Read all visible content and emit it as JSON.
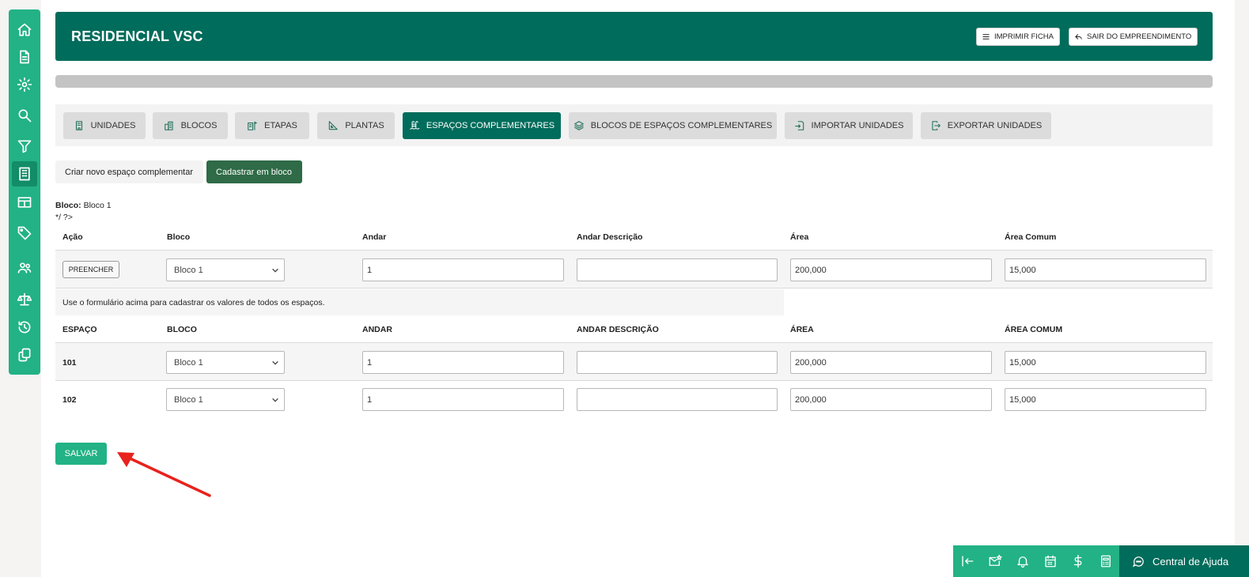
{
  "header": {
    "title": "RESIDENCIAL VSC",
    "print_label": "IMPRIMIR FICHA",
    "exit_label": "SAIR DO EMPREENDIMENTO",
    "color": "#006c5b"
  },
  "progress": {
    "percent": 0
  },
  "sidebar": {
    "items": [
      {
        "icon": "home-icon"
      },
      {
        "icon": "document-icon"
      },
      {
        "icon": "gear-icon"
      },
      {
        "icon": "search-icon"
      },
      {
        "icon": "filter-icon"
      },
      {
        "icon": "building-icon",
        "active": true
      },
      {
        "icon": "table-icon"
      },
      {
        "icon": "tag-icon"
      },
      {
        "icon": "users-icon"
      },
      {
        "icon": "scale-icon"
      },
      {
        "icon": "history-icon"
      },
      {
        "icon": "copy-icon"
      }
    ]
  },
  "tabs": [
    {
      "label": "UNIDADES",
      "icon": "building-icon"
    },
    {
      "label": "BLOCOS",
      "icon": "blocks-icon"
    },
    {
      "label": "ETAPAS",
      "icon": "buildings-flag-icon"
    },
    {
      "label": "PLANTAS",
      "icon": "ruler-triangle-icon"
    },
    {
      "label": "ESPAÇOS COMPLEMENTARES",
      "icon": "pool-icon",
      "active": true
    },
    {
      "label": "BLOCOS DE ESPAÇOS COMPLEMENTARES",
      "icon": "layers-icon"
    },
    {
      "label": "IMPORTAR UNIDADES",
      "icon": "import-icon"
    },
    {
      "label": "EXPORTAR UNIDADES",
      "icon": "export-icon"
    }
  ],
  "subtabs": {
    "create_label": "Criar novo espaço complementar",
    "bulk_label": "Cadastrar em bloco"
  },
  "info": {
    "block_label": "Bloco:",
    "block_value": "Bloco 1",
    "code_text": "*/ ?>"
  },
  "fill_table": {
    "headers": [
      "Ação",
      "Bloco",
      "Andar",
      "Andar Descrição",
      "Área",
      "Área Comum"
    ],
    "fill_button": "PREENCHER",
    "row": {
      "bloco": "Bloco 1",
      "andar": "1",
      "andar_descricao": "",
      "area": "200,000",
      "area_comum": "15,000"
    }
  },
  "note": "Use o formulário acima para cadastrar os valores de todos os espaços.",
  "spaces_table": {
    "headers": [
      "ESPAÇO",
      "BLOCO",
      "ANDAR",
      "ANDAR DESCRIÇÃO",
      "ÁREA",
      "ÁREA COMUM"
    ],
    "rows": [
      {
        "espaco": "101",
        "bloco": "Bloco 1",
        "andar": "1",
        "andar_descricao": "",
        "area": "200,000",
        "area_comum": "15,000"
      },
      {
        "espaco": "102",
        "bloco": "Bloco 1",
        "andar": "1",
        "andar_descricao": "",
        "area": "200,000",
        "area_comum": "15,000"
      }
    ]
  },
  "save_label": "SALVAR",
  "bottom_bar": {
    "icons": [
      "collapse-left-icon",
      "mail-star-icon",
      "bell-icon",
      "calendar-icon",
      "dollar-icon",
      "calculator-icon"
    ],
    "help_label": "Central de Ajuda"
  },
  "colors": {
    "accent": "#22b285",
    "dark": "#006c5b",
    "button_dark": "#2e6b46",
    "annotation_arrow": "#e8221c"
  }
}
